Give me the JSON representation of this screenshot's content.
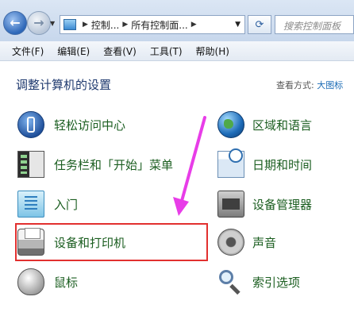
{
  "addressbar": {
    "breadcrumb": [
      "控制...",
      "所有控制面..."
    ],
    "search_placeholder": "搜索控制面板"
  },
  "menu": [
    "文件(F)",
    "编辑(E)",
    "查看(V)",
    "工具(T)",
    "帮助(H)"
  ],
  "main": {
    "heading": "调整计算机的设置",
    "view_by_label": "查看方式:",
    "view_by_value": "大图标"
  },
  "items_left": [
    {
      "label": "轻松访问中心",
      "icon": "accessibility-icon"
    },
    {
      "label": "任务栏和「开始」菜单",
      "icon": "taskbar-icon"
    },
    {
      "label": "入门",
      "icon": "getting-started-icon"
    },
    {
      "label": "设备和打印机",
      "icon": "printer-icon"
    },
    {
      "label": "鼠标",
      "icon": "mouse-icon"
    }
  ],
  "items_right": [
    {
      "label": "区域和语言",
      "icon": "globe-icon"
    },
    {
      "label": "日期和时间",
      "icon": "calendar-clock-icon"
    },
    {
      "label": "设备管理器",
      "icon": "device-manager-icon"
    },
    {
      "label": "声音",
      "icon": "speaker-icon"
    },
    {
      "label": "索引选项",
      "icon": "magnifier-icon"
    }
  ],
  "annotations": {
    "highlight_color": "#e2302f",
    "arrow_color": "#e83de8"
  }
}
